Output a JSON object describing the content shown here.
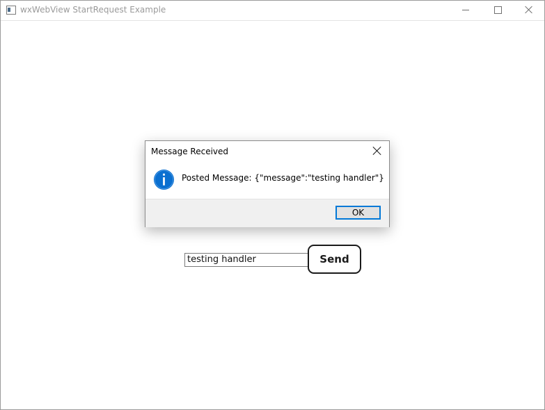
{
  "window": {
    "title": "wxWebView StartRequest Example"
  },
  "page": {
    "input_value": "testing handler",
    "send_label": "Send"
  },
  "dialog": {
    "title": "Message Received",
    "message": "Posted Message: {\"message\":\"testing handler\"}",
    "ok_label": "OK",
    "icon": "info-icon"
  },
  "colors": {
    "accent": "#0078d7",
    "info_icon": "#0a6fd0"
  }
}
